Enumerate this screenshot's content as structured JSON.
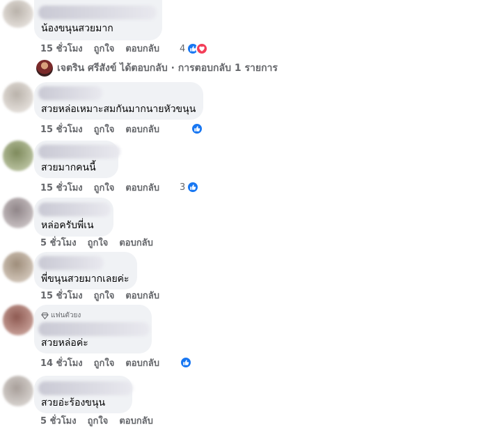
{
  "comments": [
    {
      "text": "น้องขนุนสวยมาก",
      "time": "15 ชั่วโมง",
      "like_label": "ถูกใจ",
      "reply_label": "ตอบกลับ",
      "reaction_count": "4",
      "reactions": [
        "like-icon",
        "love-icon"
      ]
    },
    {
      "text": "สวยหล่อเหมาะสมกันมากนายหัวขนุน",
      "time": "15 ชั่วโมง",
      "like_label": "ถูกใจ",
      "reply_label": "ตอบกลับ",
      "reaction_count": "",
      "reactions": [
        "like-icon"
      ]
    },
    {
      "text": "สวยมากคนนี้",
      "time": "15 ชั่วโมง",
      "like_label": "ถูกใจ",
      "reply_label": "ตอบกลับ",
      "reaction_count": "3",
      "reactions": [
        "like-icon"
      ]
    },
    {
      "text": "หล่อครับพี่เน",
      "time": "5 ชั่วโมง",
      "like_label": "ถูกใจ",
      "reply_label": "ตอบกลับ"
    },
    {
      "text": "พี่ขนุนสวยมากเลยค่ะ",
      "time": "15 ชั่วโมง",
      "like_label": "ถูกใจ",
      "reply_label": "ตอบกลับ"
    },
    {
      "badge": "แฟนตัวยง",
      "text": "สวยหล่อค่ะ",
      "time": "14 ชั่วโมง",
      "like_label": "ถูกใจ",
      "reply_label": "ตอบกลับ",
      "reaction_count": "",
      "reactions": [
        "like-icon"
      ]
    },
    {
      "text": "สวยอ่ะร้องขนุน",
      "time": "5 ชั่วโมง",
      "like_label": "ถูกใจ",
      "reply_label": "ตอบกลับ"
    }
  ],
  "reply_summary": {
    "text": "เจตริน ศรีสังข์ ได้ตอบกลับ · การตอบกลับ 1 รายการ"
  },
  "colors": {
    "bubble": "#f0f2f5",
    "meta_text": "#65676b",
    "like": "#1877f2",
    "love": "#f33e58"
  }
}
